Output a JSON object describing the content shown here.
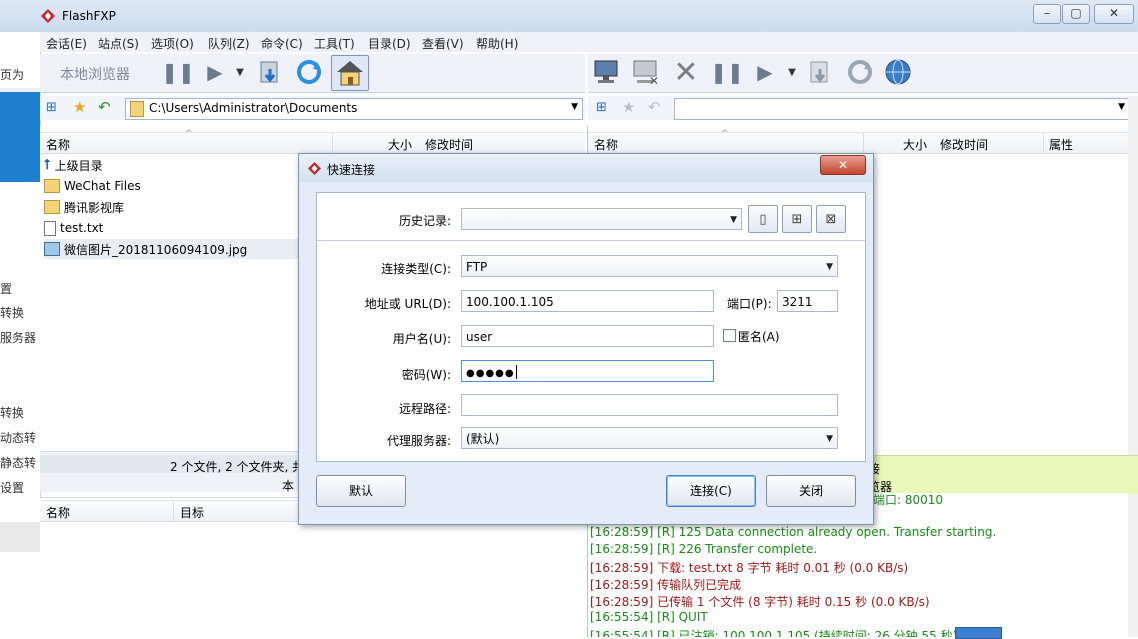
{
  "window": {
    "title": "FlashFXP"
  },
  "menu": [
    "会话(E)",
    "站点(S)",
    "选项(O)",
    "队列(Z)",
    "命令(C)",
    "工具(T)",
    "目录(D)",
    "查看(V)",
    "帮助(H)"
  ],
  "left_panel": {
    "toolbar_label": "本地浏览器",
    "path": "C:\\Users\\Administrator\\Documents",
    "columns": {
      "name": "名称",
      "size": "大小",
      "modified": "修改时间"
    },
    "files": [
      {
        "name": "上级目录",
        "icon": "up-arrow-icon"
      },
      {
        "name": "WeChat Files",
        "icon": "folder-icon"
      },
      {
        "name": "腾讯影视库",
        "icon": "folder-icon"
      },
      {
        "name": "test.txt",
        "icon": "text-file-icon"
      },
      {
        "name": "微信图片_20181106094109.jpg",
        "icon": "image-file-icon"
      }
    ],
    "status": "2 个文件, 2 个文件夹, 共",
    "status2": "本"
  },
  "right_panel": {
    "columns": {
      "name": "名称",
      "size": "大小",
      "modified": "修改时间",
      "attr": "属性"
    },
    "status_partial": "接",
    "status_partial2": "览器"
  },
  "queue": {
    "columns": {
      "name": "名称",
      "target": "目标"
    }
  },
  "left_strip": [
    "页为",
    "置",
    "转换",
    "服务器",
    "转换",
    "动态转",
    "静态转",
    "设置"
  ],
  "dialog": {
    "title": "快速连接",
    "history_label": "历史记录:",
    "history_value": "",
    "conn_type_label": "连接类型(C):",
    "conn_type_value": "FTP",
    "address_label": "地址或 URL(D):",
    "address_value": "100.100.1.105",
    "port_label": "端口(P):",
    "port_value": "3211",
    "user_label": "用户名(U):",
    "user_value": "user",
    "anon_label": "匿名(A)",
    "anon_checked": false,
    "password_label": "密码(W):",
    "password_value": "●●●●●",
    "remote_path_label": "远程路径:",
    "remote_path_value": "",
    "proxy_label": "代理服务器:",
    "proxy_value": "(默认)",
    "default_button": "默认",
    "connect_button": "连接(C)",
    "close_button": "关闭"
  },
  "log": [
    {
      "text": "[16:28:59] [R] 125 Data connection already open. Transfer starting.",
      "color": "#1a8a1a"
    },
    {
      "text": "[16:28:59] [R] 226 Transfer complete.",
      "color": "#1a8a1a"
    },
    {
      "text": "[16:28:59] 下载: test.txt 8 字节 耗时 0.01 秒 (0.0 KB/s)",
      "color": "#a01818"
    },
    {
      "text": "[16:28:59] 传输队列已完成",
      "color": "#a01818"
    },
    {
      "text": "[16:28:59] 已传输 1 个文件 (8 字节) 耗时 0.15 秒 (0.0 KB/s)",
      "color": "#a01818"
    },
    {
      "text": "[16:55:54] [R] QUIT",
      "color": "#1a8a1a"
    },
    {
      "text": "[16:55:54] [R] 已注销: 100.100.1.105 (持续时间: 26 分钟 55 秒)",
      "color": "#1a8a1a"
    }
  ],
  "log_partial_top": "端口: 80010"
}
